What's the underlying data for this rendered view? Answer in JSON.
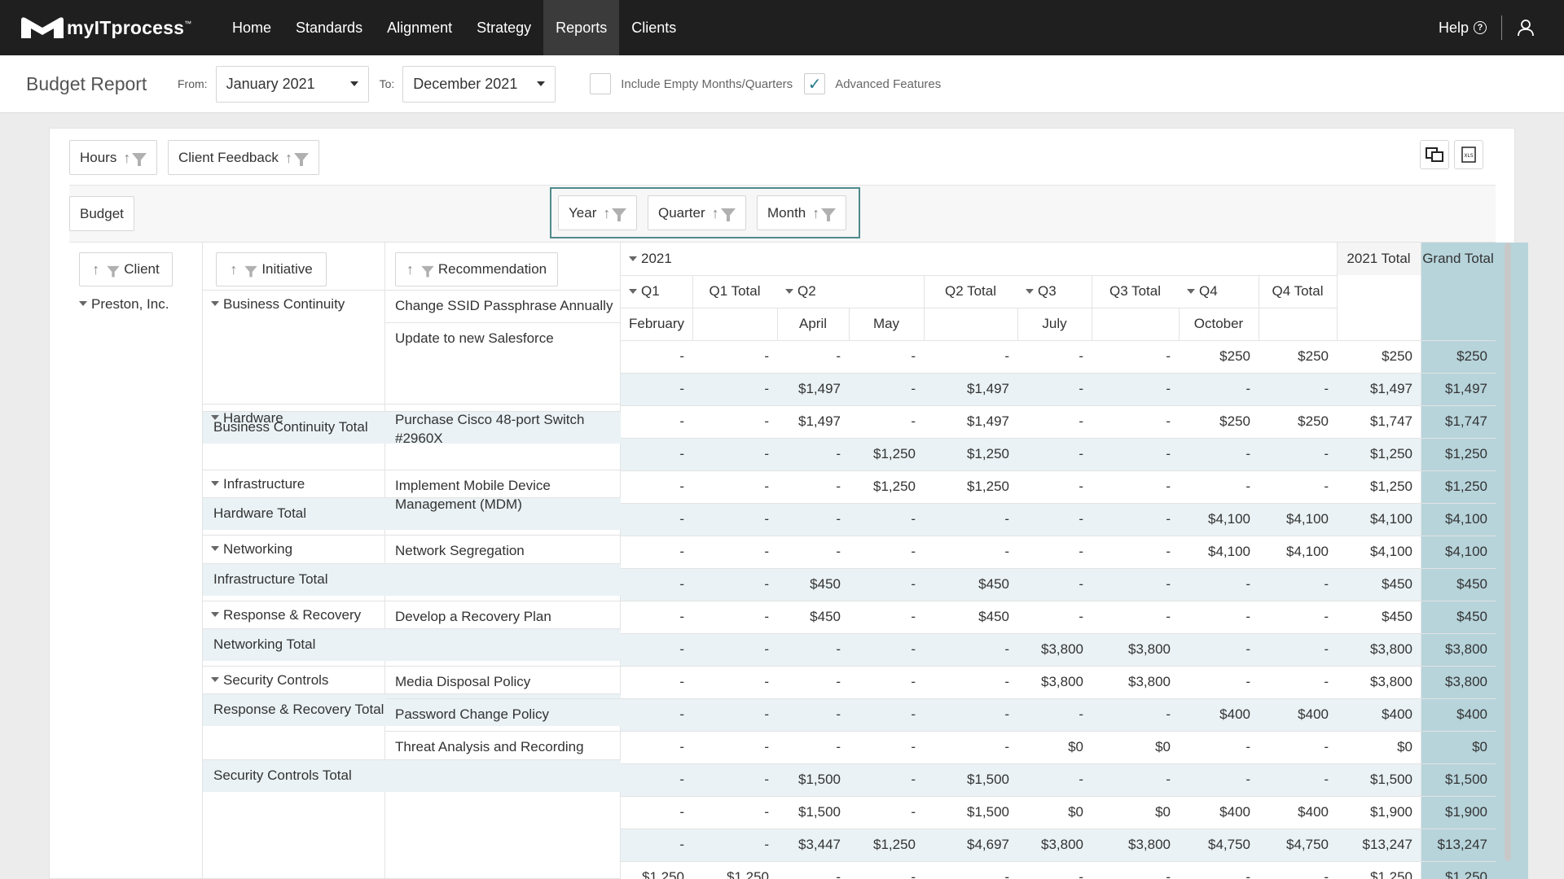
{
  "nav": {
    "logo_text": "myITprocess",
    "items": [
      "Home",
      "Standards",
      "Alignment",
      "Strategy",
      "Reports",
      "Clients"
    ],
    "active": "Reports",
    "help_label": "Help"
  },
  "header": {
    "title": "Budget Report",
    "from_label": "From:",
    "from_value": "January 2021",
    "to_label": "To:",
    "to_value": "December 2021",
    "include_empty_label": "Include Empty Months/Quarters",
    "include_empty_checked": false,
    "advanced_label": "Advanced Features",
    "advanced_checked": true
  },
  "pivot": {
    "filter_fields": [
      "Hours",
      "Client Feedback"
    ],
    "data_field": "Budget",
    "column_fields": [
      "Year",
      "Quarter",
      "Month"
    ],
    "row_fields": [
      "Client",
      "Initiative",
      "Recommendation"
    ],
    "client": "Preston, Inc.",
    "year_label": "2021",
    "year_total_label": "2021 Total",
    "grand_total_label": "Grand Total",
    "quarter_headers": [
      "Q1",
      "Q1 Total",
      "Q2",
      "Q2 Total",
      "Q3",
      "Q3 Total",
      "Q4",
      "Q4 Total"
    ],
    "month_headers": [
      "February",
      "",
      "April",
      "May",
      "",
      "July",
      "",
      "October",
      "",
      "",
      ""
    ],
    "rows": [
      {
        "initiative": "Business Continuity",
        "recommendation": "Change SSID Passphrase Annually",
        "values": [
          "-",
          "-",
          "-",
          "-",
          "-",
          "-",
          "-",
          "$250",
          "$250",
          "$250",
          "$250"
        ]
      },
      {
        "initiative": "",
        "recommendation": "Update to new Salesforce",
        "values": [
          "-",
          "-",
          "$1,497",
          "-",
          "$1,497",
          "-",
          "-",
          "-",
          "-",
          "$1,497",
          "$1,497"
        ]
      },
      {
        "total": "Business Continuity Total",
        "values": [
          "-",
          "-",
          "$1,497",
          "-",
          "$1,497",
          "-",
          "-",
          "$250",
          "$250",
          "$1,747",
          "$1,747"
        ]
      },
      {
        "initiative": "Hardware",
        "recommendation": "Purchase Cisco 48-port Switch #2960X",
        "values": [
          "-",
          "-",
          "-",
          "$1,250",
          "$1,250",
          "-",
          "-",
          "-",
          "-",
          "$1,250",
          "$1,250"
        ]
      },
      {
        "total": "Hardware Total",
        "values": [
          "-",
          "-",
          "-",
          "$1,250",
          "$1,250",
          "-",
          "-",
          "-",
          "-",
          "$1,250",
          "$1,250"
        ]
      },
      {
        "initiative": "Infrastructure",
        "recommendation": "Implement Mobile Device Management (MDM)",
        "values": [
          "-",
          "-",
          "-",
          "-",
          "-",
          "-",
          "-",
          "$4,100",
          "$4,100",
          "$4,100",
          "$4,100"
        ]
      },
      {
        "total": "Infrastructure Total",
        "values": [
          "-",
          "-",
          "-",
          "-",
          "-",
          "-",
          "-",
          "$4,100",
          "$4,100",
          "$4,100",
          "$4,100"
        ]
      },
      {
        "initiative": "Networking",
        "recommendation": "Network Segregation",
        "values": [
          "-",
          "-",
          "$450",
          "-",
          "$450",
          "-",
          "-",
          "-",
          "-",
          "$450",
          "$450"
        ]
      },
      {
        "total": "Networking Total",
        "values": [
          "-",
          "-",
          "$450",
          "-",
          "$450",
          "-",
          "-",
          "-",
          "-",
          "$450",
          "$450"
        ]
      },
      {
        "initiative": "Response & Recovery",
        "recommendation": "Develop a Recovery Plan",
        "values": [
          "-",
          "-",
          "-",
          "-",
          "-",
          "$3,800",
          "$3,800",
          "-",
          "-",
          "$3,800",
          "$3,800"
        ]
      },
      {
        "total": "Response & Recovery Total",
        "values": [
          "-",
          "-",
          "-",
          "-",
          "-",
          "$3,800",
          "$3,800",
          "-",
          "-",
          "$3,800",
          "$3,800"
        ]
      },
      {
        "initiative": "Security Controls",
        "recommendation": "Media Disposal Policy",
        "values": [
          "-",
          "-",
          "-",
          "-",
          "-",
          "-",
          "-",
          "$400",
          "$400",
          "$400",
          "$400"
        ]
      },
      {
        "initiative": "",
        "recommendation": "Password Change Policy",
        "values": [
          "-",
          "-",
          "-",
          "-",
          "-",
          "$0",
          "$0",
          "-",
          "-",
          "$0",
          "$0"
        ]
      },
      {
        "initiative": "",
        "recommendation": "Threat Analysis and Recording",
        "values": [
          "-",
          "-",
          "$1,500",
          "-",
          "$1,500",
          "-",
          "-",
          "-",
          "-",
          "$1,500",
          "$1,500"
        ]
      },
      {
        "total": "Security Controls Total",
        "values": [
          "-",
          "-",
          "$1,500",
          "-",
          "$1,500",
          "$0",
          "$0",
          "$400",
          "$400",
          "$1,900",
          "$1,900"
        ]
      },
      {
        "total": "",
        "values": [
          "-",
          "-",
          "$3,447",
          "$1,250",
          "$4,697",
          "$3,800",
          "$3,800",
          "$4,750",
          "$4,750",
          "$13,247",
          "$13,247"
        ]
      },
      {
        "total": "",
        "values": [
          "$1,250",
          "$1,250",
          "-",
          "-",
          "-",
          "-",
          "-",
          "-",
          "-",
          "$1,250",
          "$1,250"
        ]
      }
    ]
  }
}
